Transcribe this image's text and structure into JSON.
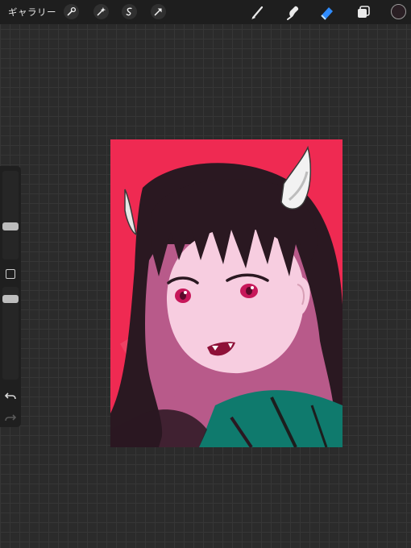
{
  "toolbar": {
    "gallery_label": "ギャラリー",
    "left_icons": [
      "wrench-icon",
      "magic-wand-icon",
      "selection-icon",
      "transform-arrow-icon"
    ],
    "right_icons": [
      "brush-icon",
      "smudge-icon",
      "eraser-icon",
      "layers-icon"
    ],
    "active_tool": "eraser",
    "current_color": "#2a1f24"
  },
  "sidebar": {
    "brush_size_level": 0.45,
    "opacity_level": 0.3
  },
  "canvas": {
    "background_color": "#ef2a52"
  }
}
